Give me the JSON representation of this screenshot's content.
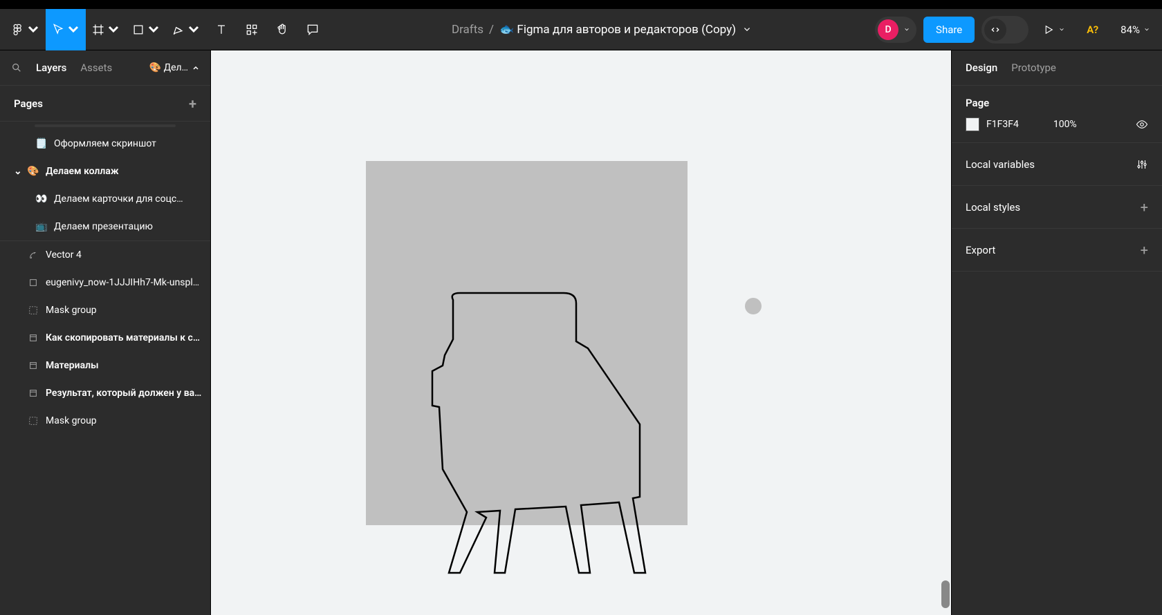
{
  "breadcrumb": {
    "drafts": "Drafts",
    "sep": "/",
    "file": "🐟 Figma для авторов и редакторов (Copy)"
  },
  "avatar": {
    "initial": "D"
  },
  "share": "Share",
  "a_badge": "A?",
  "zoom": "84%",
  "left": {
    "search_icon": "search",
    "tab_layers": "Layers",
    "tab_assets": "Assets",
    "page_selector": "🎨 Дел…",
    "pages_label": "Pages"
  },
  "layers": [
    {
      "emoji": "🗒️",
      "label": "Оформляем скриншот",
      "indent": true
    },
    {
      "emoji": "🎨",
      "label": "Делаем коллаж",
      "bold": true,
      "caret": true
    },
    {
      "emoji": "👀",
      "label": "Делаем карточки для соцс…",
      "indent": true
    },
    {
      "emoji": "📺",
      "label": "Делаем презентацию",
      "indent": true
    },
    {
      "icon": "vector",
      "label": "Vector 4"
    },
    {
      "icon": "frame",
      "label": "eugenivy_now-1JJJIHh7-Mk-unspl…"
    },
    {
      "icon": "mask",
      "label": "Mask group"
    },
    {
      "icon": "component",
      "label": "Как скопировать материалы к с…",
      "bold": true
    },
    {
      "icon": "component",
      "label": "Материалы",
      "bold": true
    },
    {
      "icon": "component",
      "label": "Результат, который должен у ва…",
      "bold": true
    },
    {
      "icon": "mask",
      "label": "Mask group"
    }
  ],
  "right": {
    "tab_design": "Design",
    "tab_prototype": "Prototype",
    "page_label": "Page",
    "color": "F1F3F4",
    "opacity": "100%",
    "local_vars": "Local variables",
    "local_styles": "Local styles",
    "export": "Export"
  }
}
